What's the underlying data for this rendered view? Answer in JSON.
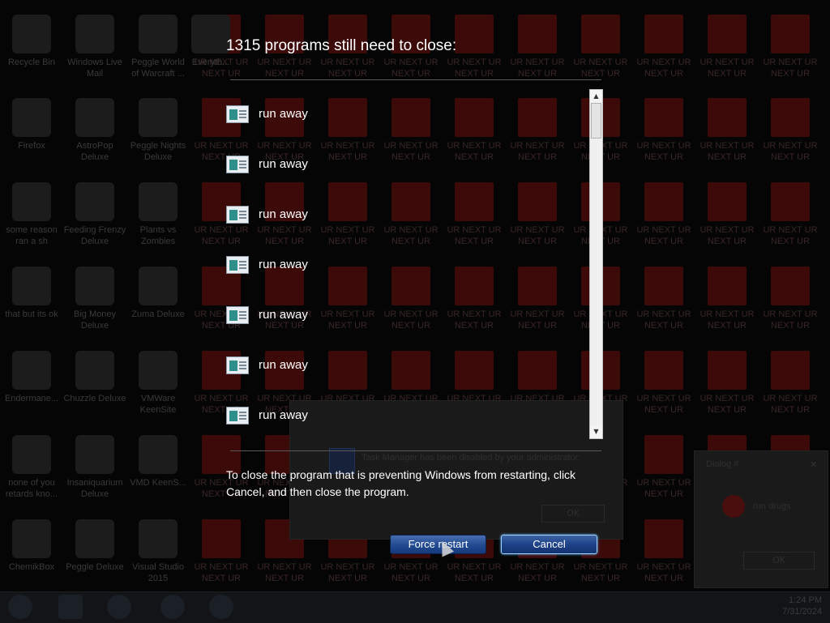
{
  "desktop_icons": [
    {
      "label": "Recycle Bin"
    },
    {
      "label": "Windows Live Mail"
    },
    {
      "label": "Peggle World of Warcraft ..."
    },
    {
      "label": "Everyth..."
    },
    {
      "label": "Firefox"
    },
    {
      "label": "AstroPop Deluxe"
    },
    {
      "label": "Peggle Nights Deluxe"
    },
    {
      "label": "some reason ran a sh"
    },
    {
      "label": "Feeding Frenzy Deluxe"
    },
    {
      "label": "Plants vs Zombies"
    },
    {
      "label": "that but its ok"
    },
    {
      "label": "Big Money Deluxe"
    },
    {
      "label": "Zuma Deluxe"
    },
    {
      "label": "Endermane..."
    },
    {
      "label": "Chuzzle Deluxe"
    },
    {
      "label": "VMWare KeenSite"
    },
    {
      "label": "none of you retards kno..."
    },
    {
      "label": "Insaniquarium Deluxe"
    },
    {
      "label": "VMD KeenS..."
    },
    {
      "label": "ChemikBox"
    },
    {
      "label": "Peggle Deluxe"
    },
    {
      "label": "Visual Studio 2015"
    }
  ],
  "tile_caption": "UR NEXT UR NEXT UR",
  "headline": "1315 programs still need to close:",
  "programs": [
    {
      "name": "run away"
    },
    {
      "name": "run away"
    },
    {
      "name": "run away"
    },
    {
      "name": "run away"
    },
    {
      "name": "run away"
    },
    {
      "name": "run away"
    },
    {
      "name": "run away"
    }
  ],
  "message": "To close the program that is preventing Windows from restarting, click Cancel, and then close the program.",
  "buttons": {
    "force_restart": "Force restart",
    "cancel": "Cancel"
  },
  "ghost_dialogs": {
    "main_text": "Task Manager has been disabled by your administrator.",
    "main_ok": "OK",
    "side_title": "Dialog #",
    "side_text": "run drugs",
    "side_ok": "OK"
  },
  "clock": {
    "time": "1:24 PM",
    "date": "7/31/2024"
  }
}
